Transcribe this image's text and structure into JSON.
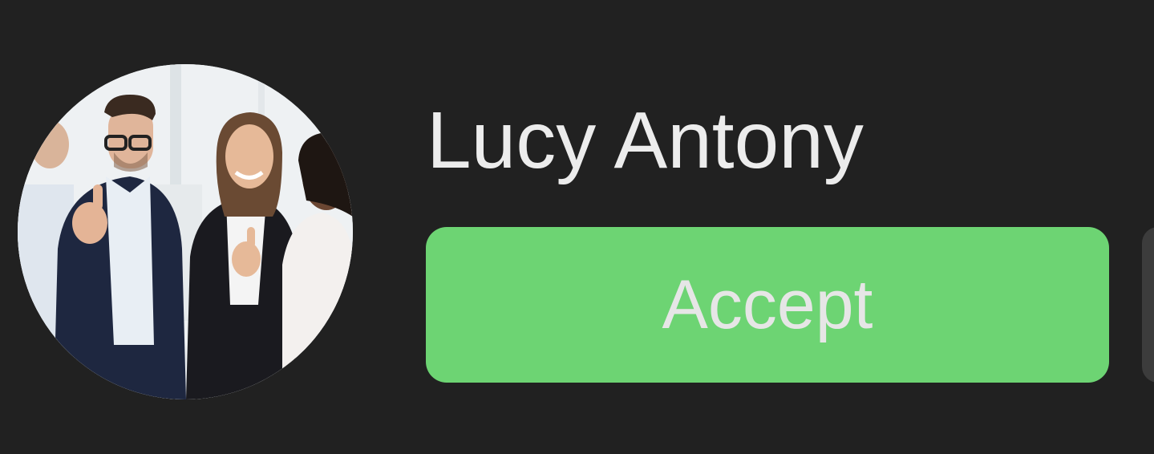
{
  "contact": {
    "name": "Lucy Antony",
    "avatar_icon": "profile-photo"
  },
  "actions": {
    "accept_label": "Accept"
  },
  "colors": {
    "background": "#212121",
    "accept": "#6dd473",
    "name_text": "#ececec",
    "button_text": "#e6e6e6",
    "secondary_button": "#3c3c3c"
  }
}
